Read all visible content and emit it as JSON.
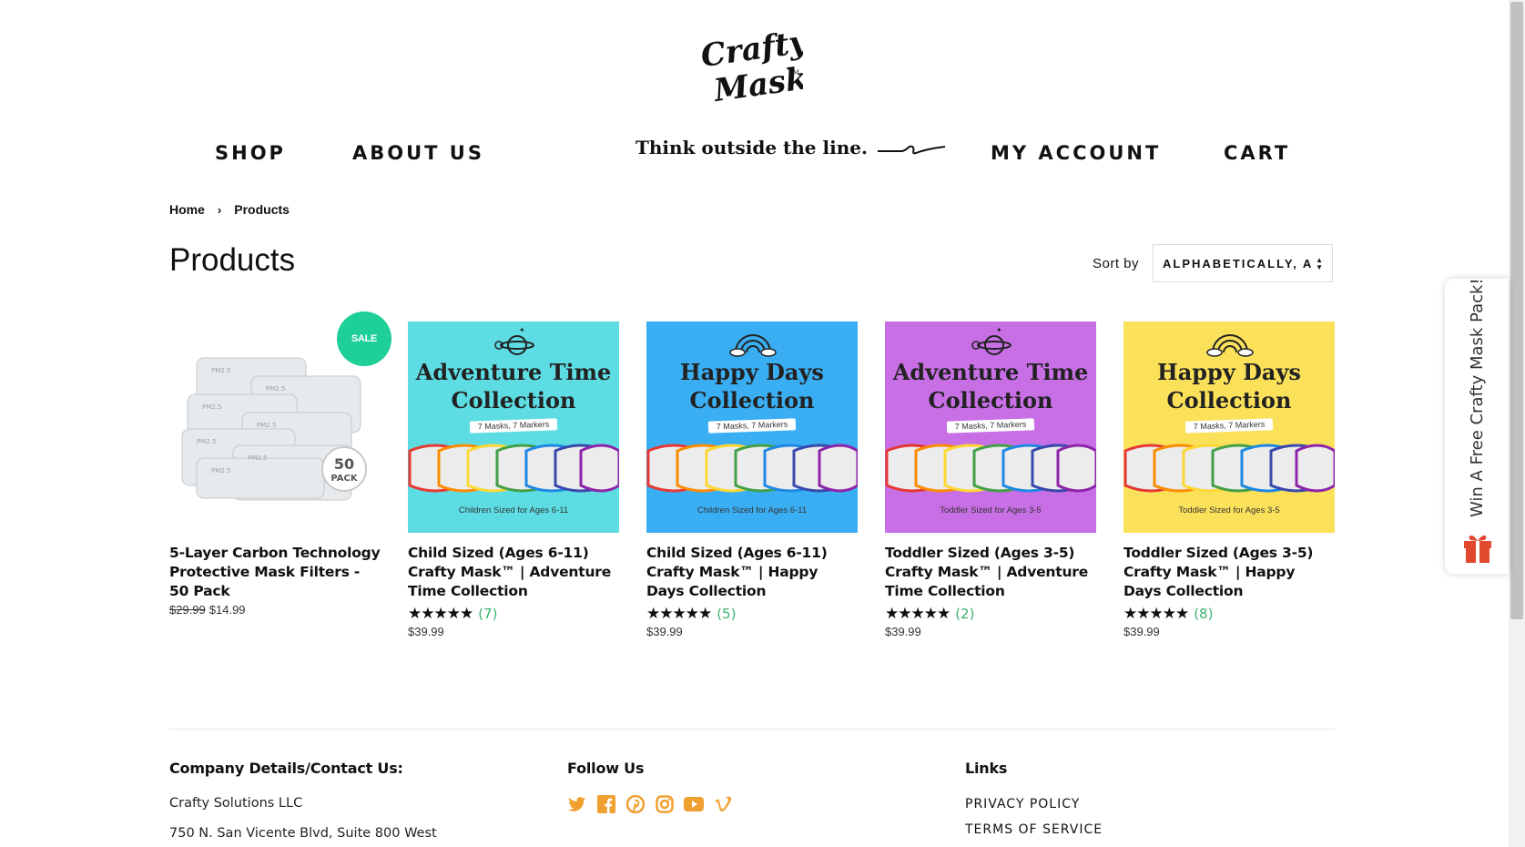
{
  "logo": {
    "line1": "Crafty",
    "line2": "Mask",
    "tm": "TM"
  },
  "nav": {
    "shop": "SHOP",
    "about": "ABOUT US",
    "tagline": "Think outside the line.",
    "account": "MY ACCOUNT",
    "cart": "CART"
  },
  "breadcrumb": {
    "home": "Home",
    "sep": "›",
    "current": "Products"
  },
  "page_title": "Products",
  "sort": {
    "label": "Sort by",
    "value": "ALPHABETICALLY, A"
  },
  "products": [
    {
      "title": "5-Layer Carbon Technology Protective Mask Filters - 50 Pack",
      "price_old": "$29.99",
      "price": "$14.99",
      "badge": "SALE",
      "pack_number": "50",
      "pack_word": "PACK",
      "filter_label": "PM2.5"
    },
    {
      "title": "Child Sized (Ages 6-11) Crafty Mask™ | Adventure Time Collection",
      "stars": "★★★★★",
      "reviews": "(7)",
      "price": "$39.99",
      "card_title_1": "Adventure Time",
      "card_title_2": "Collection",
      "card_sub": "7 Masks, 7 Markers",
      "card_footer": "Children Sized for Ages 6-11",
      "bg": "#5ddde3",
      "icon": "planet-icon"
    },
    {
      "title": "Child Sized (Ages 6-11) Crafty Mask™ | Happy Days Collection",
      "stars": "★★★★★",
      "reviews": "(5)",
      "price": "$39.99",
      "card_title_1": "Happy Days",
      "card_title_2": "Collection",
      "card_sub": "7 Masks, 7 Markers",
      "card_footer": "Children Sized for Ages 6-11",
      "bg": "#3aaef3",
      "icon": "rainbow-icon"
    },
    {
      "title": "Toddler Sized (Ages 3-5) Crafty Mask™ | Adventure Time Collection",
      "stars": "★★★★★",
      "reviews": "(2)",
      "price": "$39.99",
      "card_title_1": "Adventure Time",
      "card_title_2": "Collection",
      "card_sub": "7 Masks, 7 Markers",
      "card_footer": "Toddler Sized for Ages 3-5",
      "bg": "#c86fe6",
      "icon": "planet-icon"
    },
    {
      "title": "Toddler Sized (Ages 3-5) Crafty Mask™ | Happy Days Collection",
      "stars": "★★★★★",
      "reviews": "(8)",
      "price": "$39.99",
      "card_title_1": "Happy Days",
      "card_title_2": "Collection",
      "card_sub": "7 Masks, 7 Markers",
      "card_footer": "Toddler Sized for Ages 3-5",
      "bg": "#fbe15a",
      "icon": "rainbow-icon"
    }
  ],
  "footer": {
    "company_heading": "Company Details/Contact Us:",
    "company_name": "Crafty Solutions LLC",
    "address": "750 N. San Vicente Blvd, Suite 800 West",
    "follow_heading": "Follow Us",
    "social": [
      "twitter-icon",
      "facebook-icon",
      "pinterest-icon",
      "instagram-icon",
      "youtube-icon",
      "vimeo-icon"
    ],
    "links_heading": "Links",
    "privacy": "PRIVACY POLICY",
    "terms": "TERMS OF SERVICE"
  },
  "widget": {
    "text": "Win A Free Crafty Mask Pack!",
    "icon": "gift-icon"
  },
  "colors": {
    "accent_green": "#1ecf97",
    "review_green": "#3cb371",
    "social_orange": "#f0a030"
  }
}
